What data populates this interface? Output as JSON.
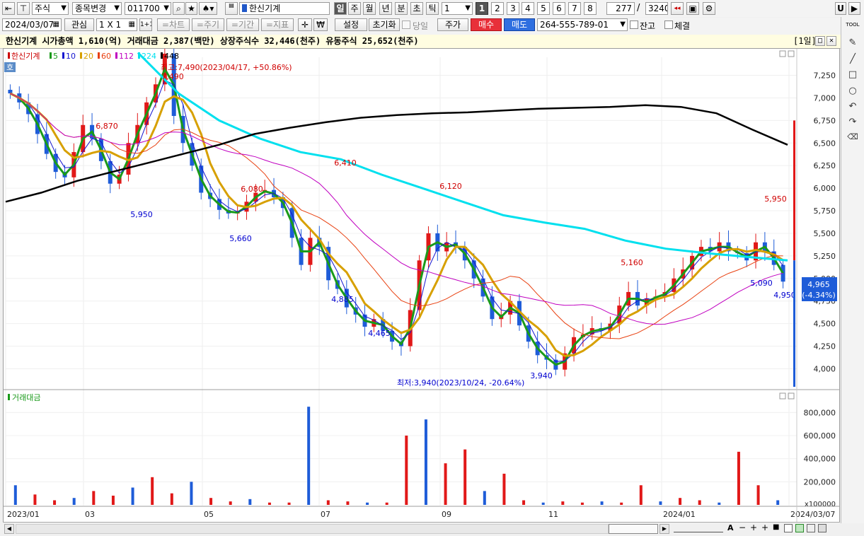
{
  "toolbar1": {
    "market_type": "주식",
    "change_mode": "종목변경",
    "stock_code": "011700",
    "stock_name": "한신기계",
    "periods": [
      "일",
      "주",
      "월",
      "년",
      "분",
      "초",
      "틱"
    ],
    "interval_value": "1",
    "chart_numbers": [
      "1",
      "2",
      "3",
      "4",
      "5",
      "6",
      "7",
      "8"
    ],
    "display_count": "277",
    "total_count": "3240",
    "right_icon_u": "U"
  },
  "toolbar2": {
    "date": "2024/03/07",
    "watch_label": "관심",
    "layout_label": "1 X 1",
    "layout_icon": "1+1",
    "chart_button": "=차트",
    "cycle_button": "=주기",
    "period_button": "=기간",
    "indicator_button": "=지표",
    "currency_icon": "₩",
    "settings_button": "설정",
    "reset_button": "초기화",
    "same_day_label": "당일",
    "price_button": "주가",
    "buy_button": "매수",
    "sell_button": "매도",
    "account": "264-555-789-01",
    "balance_label": "잔고",
    "fill_label": "체결"
  },
  "info_bar": {
    "text": "한신기계  시가총액 1,610(억)  거래대금 2,387(백만)  상장주식수 32,446(천주)  유동주식 25,652(천주)",
    "period_badge": "[1일]"
  },
  "chart_data": [
    {
      "type": "candlestick",
      "title": "한신기계",
      "legend": [
        {
          "name": "한신기계",
          "color": "#cc0000"
        },
        {
          "name": "5",
          "color": "#1a9a1a"
        },
        {
          "name": "10",
          "color": "#1515d0"
        },
        {
          "name": "20",
          "color": "#d7a000"
        },
        {
          "name": "60",
          "color": "#e84010"
        },
        {
          "name": "112",
          "color": "#c000c0"
        },
        {
          "name": "224",
          "color": "#00e0ee"
        },
        {
          "name": "448",
          "color": "#000000"
        }
      ],
      "ylim": [
        3800,
        7450
      ],
      "y_ticks": [
        "7,250",
        "7,000",
        "6,750",
        "6,500",
        "6,250",
        "6,000",
        "5,750",
        "5,500",
        "5,250",
        "5,000",
        "4,750",
        "4,500",
        "4,250",
        "4,000"
      ],
      "x_ticks": [
        "2023/01",
        "03",
        "05",
        "07",
        "09",
        "11",
        "2024/01",
        "2024/03/07"
      ],
      "annotations": [
        {
          "text": "최고:7,490(2023/04/17, +50.86%)",
          "color": "#d00000"
        },
        {
          "text": "최저:3,940(2023/10/24, -20.64%)",
          "color": "#0000d0"
        },
        {
          "text": "7,490",
          "color": "#d00000"
        },
        {
          "text": "6,870",
          "color": "#d00000"
        },
        {
          "text": "6,410",
          "color": "#d00000"
        },
        {
          "text": "6,080",
          "color": "#d00000"
        },
        {
          "text": "6,120",
          "color": "#d00000"
        },
        {
          "text": "5,160",
          "color": "#d00000"
        },
        {
          "text": "5,950",
          "color": "#d00000"
        },
        {
          "text": "5,950",
          "color": "#0000d0"
        },
        {
          "text": "5,660",
          "color": "#0000d0"
        },
        {
          "text": "4,885",
          "color": "#0000d0"
        },
        {
          "text": "4,465",
          "color": "#0000d0"
        },
        {
          "text": "3,940",
          "color": "#0000d0"
        },
        {
          "text": "5,090",
          "color": "#0000d0"
        },
        {
          "text": "4,950",
          "color": "#0000d0"
        }
      ],
      "last_price": "4,965",
      "last_change": "(-4.34%)",
      "series": [
        {
          "name": "종가",
          "values": [
            7050,
            6950,
            6820,
            6600,
            6380,
            6180,
            6120,
            6400,
            6700,
            6550,
            6300,
            6050,
            6150,
            6500,
            6700,
            6950,
            7150,
            7490,
            6800,
            6500,
            6250,
            5950,
            5880,
            5760,
            5720,
            5740,
            5850,
            5950,
            5980,
            5900,
            5780,
            5450,
            5150,
            5450,
            5350,
            4980,
            4885,
            4680,
            4600,
            4465,
            4550,
            4420,
            4300,
            4250,
            4650,
            5200,
            5500,
            5300,
            5400,
            5350,
            5200,
            5000,
            4800,
            4550,
            4600,
            4750,
            4480,
            4300,
            4150,
            4100,
            3990,
            4170,
            4350,
            4380,
            4450,
            4420,
            4500,
            4700,
            4850,
            4700,
            4780,
            4800,
            4850,
            5000,
            5100,
            5250,
            5350,
            5300,
            5400,
            5300,
            5280,
            5200,
            5400,
            5300,
            5150,
            4965
          ]
        },
        {
          "name": "448",
          "values": [
            5850,
            5950,
            6080,
            6180,
            6280,
            6380,
            6480,
            6600,
            6670,
            6730,
            6780,
            6810,
            6830,
            6840,
            6860,
            6880,
            6890,
            6900,
            6920,
            6900,
            6830,
            6650,
            6480
          ]
        },
        {
          "name": "224",
          "values": [
            7500,
            7050,
            6750,
            6550,
            6400,
            6320,
            6150,
            6000,
            5850,
            5700,
            5620,
            5550,
            5420,
            5330,
            5280,
            5240,
            5200
          ]
        }
      ]
    },
    {
      "type": "bar",
      "title": "거래대금",
      "ylim": [
        0,
        900000
      ],
      "y_ticks": [
        "800,000",
        "600,000",
        "400,000",
        "200,000"
      ],
      "unit_label": "x100000",
      "values": [
        170000,
        90000,
        40000,
        60000,
        120000,
        80000,
        150000,
        240000,
        100000,
        200000,
        60000,
        30000,
        50000,
        20000,
        20000,
        850000,
        40000,
        30000,
        20000,
        20000,
        600000,
        740000,
        360000,
        480000,
        120000,
        270000,
        40000,
        20000,
        30000,
        20000,
        30000,
        20000,
        170000,
        30000,
        60000,
        40000,
        20000,
        460000,
        170000,
        40000
      ]
    }
  ],
  "bottom_buttons": [
    "A",
    "−",
    "+",
    "+",
    "■"
  ],
  "right_tools": [
    "TOOL",
    "pen-icon",
    "line-icon",
    "rect-icon",
    "circle-icon",
    "undo-icon",
    "redo-icon",
    "erase-all-icon"
  ]
}
